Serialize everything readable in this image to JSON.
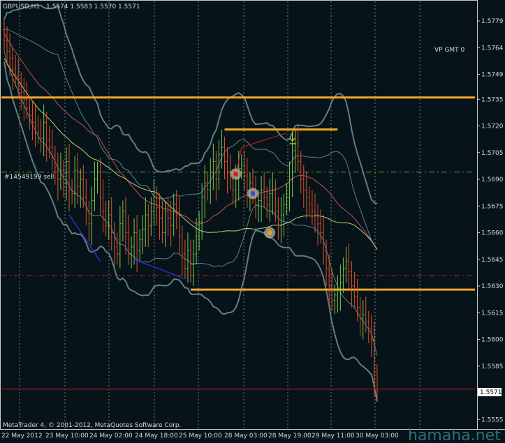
{
  "header": {
    "symbol": "GBPUSD,H1",
    "ohlc": "1.5574 1.5583 1.5570 1.5571"
  },
  "indicator_label": "VP GMT 0",
  "order_label": "#14549199 sell",
  "footer": "MetaTrader 4, © 2001-2012, MetaQuotes Software Corp.",
  "watermark": "hamaha.net",
  "colors": {
    "background": "#06141a",
    "bull_candle": "#7ec84a",
    "bear_candle": "#e0502a",
    "orange_level": "#f5a623",
    "bollinger": "#5f7f82",
    "ma_red": "#c0504d",
    "ma_yellow": "#c8c878",
    "dashed_green": "#5aa02a",
    "dashed_red": "#b02020"
  },
  "chart_data": {
    "type": "candlestick",
    "ylim": [
      1.555,
      1.579
    ],
    "price_ticks": [
      "1.5779",
      "1.5764",
      "1.5749",
      "1.5735",
      "1.5720",
      "1.5705",
      "1.5690",
      "1.5675",
      "1.5660",
      "1.5645",
      "1.5630",
      "1.5615",
      "1.5600",
      "1.5585",
      "1.5555"
    ],
    "current_price": "1.5571",
    "time_labels": [
      "22 May 2012",
      "23 May 10:00",
      "24 May 02:00",
      "24 May 18:00",
      "25 May 10:00",
      "28 May 03:00",
      "28 May 19:00",
      "29 May 11:00",
      "30 May 03:00"
    ],
    "levels": [
      {
        "name": "resistance",
        "price": 1.5736,
        "from_index": 0,
        "to_index": 150
      },
      {
        "name": "support",
        "price": 1.5628,
        "from_index": 66,
        "to_index": 150
      },
      {
        "name": "range-top",
        "price": 1.5718,
        "from_index": 78,
        "to_index": 118
      }
    ],
    "dashed_levels": [
      {
        "name": "order-entry",
        "price": 1.5694
      },
      {
        "name": "stop",
        "price": 1.5636
      }
    ],
    "closes": [
      1.5768,
      1.5762,
      1.5758,
      1.5752,
      1.5748,
      1.5744,
      1.5739,
      1.5735,
      1.573,
      1.5726,
      1.5722,
      1.572,
      1.5716,
      1.5713,
      1.5722,
      1.5712,
      1.5708,
      1.5703,
      1.5697,
      1.569,
      1.5695,
      1.5688,
      1.57,
      1.5684,
      1.5682,
      1.5695,
      1.5686,
      1.569,
      1.568,
      1.5672,
      1.5665,
      1.5678,
      1.569,
      1.5694,
      1.568,
      1.5672,
      1.5664,
      1.567,
      1.566,
      1.5652,
      1.5648,
      1.5665,
      1.5672,
      1.566,
      1.5648,
      1.5652,
      1.566,
      1.565,
      1.5656,
      1.5662,
      1.567,
      1.5664,
      1.5672,
      1.568,
      1.5674,
      1.5668,
      1.566,
      1.5672,
      1.5668,
      1.5664,
      1.5676,
      1.567,
      1.5658,
      1.5648,
      1.564,
      1.565,
      1.5642,
      1.5648,
      1.5658,
      1.5666,
      1.568,
      1.5688,
      1.5684,
      1.5694,
      1.57,
      1.569,
      1.5704,
      1.5708,
      1.57,
      1.5694,
      1.569,
      1.5684,
      1.569,
      1.5696,
      1.5698,
      1.5692,
      1.5684,
      1.5688,
      1.5682,
      1.5676,
      1.5678,
      1.5684,
      1.568,
      1.5676,
      1.5682,
      1.5684,
      1.5672,
      1.5664,
      1.567,
      1.5676,
      1.568,
      1.569,
      1.5706,
      1.571,
      1.57,
      1.569,
      1.5684,
      1.568,
      1.5676,
      1.5672,
      1.567,
      1.5665,
      1.566,
      1.565,
      1.564,
      1.563,
      1.5622,
      1.5625,
      1.5628,
      1.5632,
      1.564,
      1.5644,
      1.5638,
      1.563,
      1.5624,
      1.5618,
      1.5612,
      1.5614,
      1.561,
      1.5606,
      1.56,
      1.558,
      1.5571
    ]
  }
}
